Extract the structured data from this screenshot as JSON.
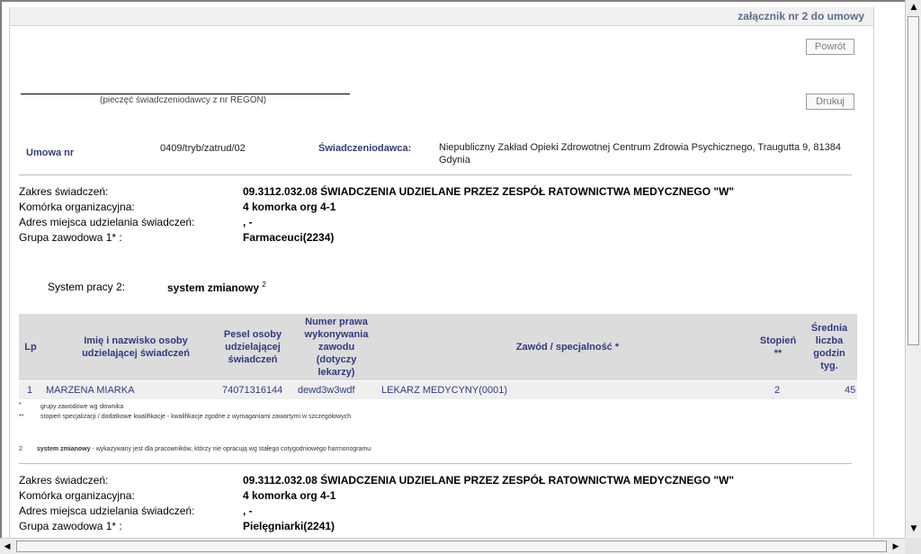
{
  "header": {
    "title": "załącznik nr 2 do umowy"
  },
  "buttons": {
    "back": "Powrót",
    "print": "Drukuj"
  },
  "stamp_label": "(pieczęć świadczeniodawcy z nr REGON)",
  "contract": {
    "number_label": "Umowa nr",
    "number_value": "0409/tryb/zatrud/02",
    "provider_label": "Świadczeniodawca:",
    "provider_value_line1": "Niepubliczny Zakład Opieki Zdrowotnej Centrum Zdrowia Psychicznego, Traugutta 9, 81384",
    "provider_value_line2": "Gdynia"
  },
  "section1": {
    "zakres_label": "Zakres świadczeń:",
    "zakres_value": "09.3112.032.08 ŚWIADCZENIA UDZIELANE PRZEZ ZESPÓŁ RATOWNICTWA MEDYCZNEGO \"W\"",
    "komorka_label": "Komórka organizacyjna:",
    "komorka_value": "4 komorka org 4-1",
    "adres_label": "Adres miejsca udzielania świadczeń:",
    "adres_value": ", -",
    "grupa_label": "Grupa zawodowa 1* :",
    "grupa_value": "Farmaceuci(2234)",
    "system_label": "System pracy 2:",
    "system_value": "system zmianowy",
    "system_sup": "2"
  },
  "table": {
    "headers": {
      "lp": "Lp",
      "name": [
        "Imię i nazwisko osoby",
        "udzielającej świadczeń"
      ],
      "pesel": [
        "Pesel osoby",
        "udzielającej",
        "świadczeń"
      ],
      "license": [
        "Numer prawa",
        "wykonywania",
        "zawodu",
        "(dotyczy",
        "lekarzy)"
      ],
      "profession": "Zawód / specjalność *",
      "degree": [
        "Stopień",
        "**"
      ],
      "hours": [
        "Średnia",
        "liczba",
        "godzin",
        "tyg."
      ]
    },
    "rows": [
      {
        "lp": "1",
        "name": "MARZENA MIARKA",
        "pesel": "74071316144",
        "license": "dewd3w3wdf",
        "profession": "LEKARZ MEDYCYNY(0001)",
        "degree": "2",
        "hours": "45"
      }
    ]
  },
  "footnotes": {
    "f1_mark": "*",
    "f1_text": "grupy zawodowe wg słownika",
    "f2_mark": "**",
    "f2_text": "stopień specjalizacji / dodatkowe kwalifikacje - kwalifikacje zgodne z wymaganiami zawartymi w szczegółowych",
    "f3_mark": "2",
    "f3_bold": "system zmianowy",
    "f3_text": " - wykazywany jest dla pracowników, którzy nie opracują wg stałego cotygodniowego harmonogramu"
  },
  "section2": {
    "zakres_label": "Zakres świadczeń:",
    "zakres_value": "09.3112.032.08 ŚWIADCZENIA UDZIELANE PRZEZ ZESPÓŁ RATOWNICTWA MEDYCZNEGO \"W\"",
    "komorka_label": "Komórka organizacyjna:",
    "komorka_value": "4 komorka org 4-1",
    "adres_label": "Adres miejsca udzielania świadczeń:",
    "adres_value": ", -",
    "grupa_label": "Grupa zawodowa 1* :",
    "grupa_value": "Pielęgniarki(2241)"
  }
}
